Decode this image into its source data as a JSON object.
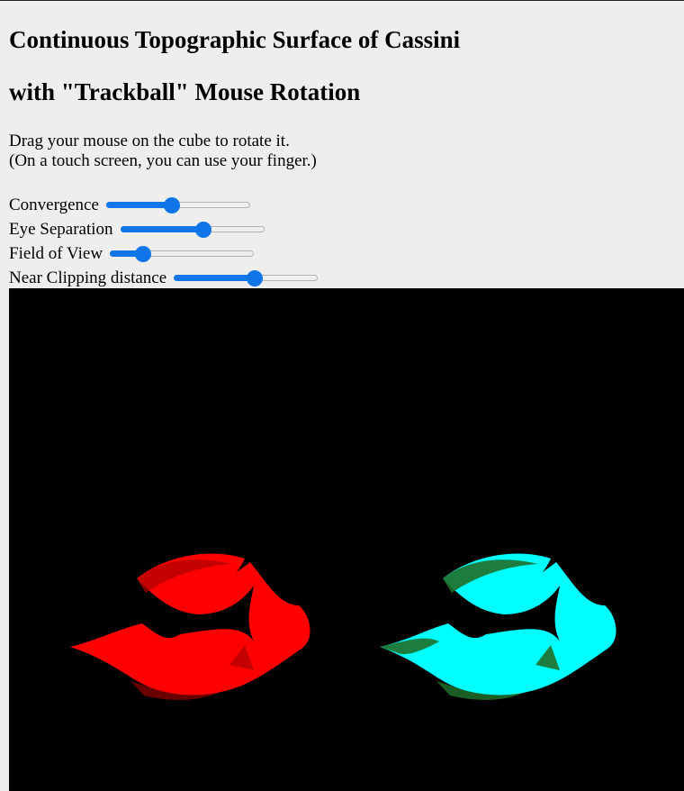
{
  "page": {
    "title_line1": "Continuous Topographic Surface of Cassini",
    "title_line2": "with \"Trackball\" Mouse Rotation",
    "instruction_line1": "Drag your mouse on the cube to rotate it.",
    "instruction_line2": "(On a touch screen, you can use your finger.)"
  },
  "controls": [
    {
      "label": "Convergence",
      "value_fraction": 0.46
    },
    {
      "label": "Eye Separation",
      "value_fraction": 0.58
    },
    {
      "label": "Field of View",
      "value_fraction": 0.23
    },
    {
      "label": "Near Clipping distance",
      "value_fraction": 0.56
    }
  ],
  "viewport": {
    "background_color": "#000000",
    "left_eye_color": "#ff0000",
    "right_eye_color": "#00ffff",
    "right_eye_shadow_color": "#1f6f2a"
  },
  "accent_color": "#0f75e8"
}
